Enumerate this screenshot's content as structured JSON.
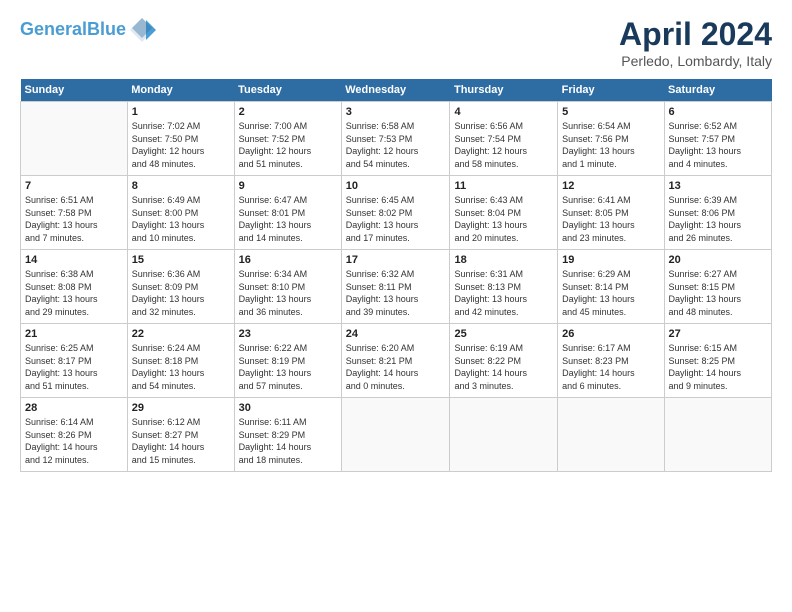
{
  "header": {
    "logo_line1": "General",
    "logo_line2": "Blue",
    "title": "April 2024",
    "subtitle": "Perledo, Lombardy, Italy"
  },
  "days_of_week": [
    "Sunday",
    "Monday",
    "Tuesday",
    "Wednesday",
    "Thursday",
    "Friday",
    "Saturday"
  ],
  "weeks": [
    [
      {
        "day": "",
        "info": ""
      },
      {
        "day": "1",
        "info": "Sunrise: 7:02 AM\nSunset: 7:50 PM\nDaylight: 12 hours\nand 48 minutes."
      },
      {
        "day": "2",
        "info": "Sunrise: 7:00 AM\nSunset: 7:52 PM\nDaylight: 12 hours\nand 51 minutes."
      },
      {
        "day": "3",
        "info": "Sunrise: 6:58 AM\nSunset: 7:53 PM\nDaylight: 12 hours\nand 54 minutes."
      },
      {
        "day": "4",
        "info": "Sunrise: 6:56 AM\nSunset: 7:54 PM\nDaylight: 12 hours\nand 58 minutes."
      },
      {
        "day": "5",
        "info": "Sunrise: 6:54 AM\nSunset: 7:56 PM\nDaylight: 13 hours\nand 1 minute."
      },
      {
        "day": "6",
        "info": "Sunrise: 6:52 AM\nSunset: 7:57 PM\nDaylight: 13 hours\nand 4 minutes."
      }
    ],
    [
      {
        "day": "7",
        "info": "Sunrise: 6:51 AM\nSunset: 7:58 PM\nDaylight: 13 hours\nand 7 minutes."
      },
      {
        "day": "8",
        "info": "Sunrise: 6:49 AM\nSunset: 8:00 PM\nDaylight: 13 hours\nand 10 minutes."
      },
      {
        "day": "9",
        "info": "Sunrise: 6:47 AM\nSunset: 8:01 PM\nDaylight: 13 hours\nand 14 minutes."
      },
      {
        "day": "10",
        "info": "Sunrise: 6:45 AM\nSunset: 8:02 PM\nDaylight: 13 hours\nand 17 minutes."
      },
      {
        "day": "11",
        "info": "Sunrise: 6:43 AM\nSunset: 8:04 PM\nDaylight: 13 hours\nand 20 minutes."
      },
      {
        "day": "12",
        "info": "Sunrise: 6:41 AM\nSunset: 8:05 PM\nDaylight: 13 hours\nand 23 minutes."
      },
      {
        "day": "13",
        "info": "Sunrise: 6:39 AM\nSunset: 8:06 PM\nDaylight: 13 hours\nand 26 minutes."
      }
    ],
    [
      {
        "day": "14",
        "info": "Sunrise: 6:38 AM\nSunset: 8:08 PM\nDaylight: 13 hours\nand 29 minutes."
      },
      {
        "day": "15",
        "info": "Sunrise: 6:36 AM\nSunset: 8:09 PM\nDaylight: 13 hours\nand 32 minutes."
      },
      {
        "day": "16",
        "info": "Sunrise: 6:34 AM\nSunset: 8:10 PM\nDaylight: 13 hours\nand 36 minutes."
      },
      {
        "day": "17",
        "info": "Sunrise: 6:32 AM\nSunset: 8:11 PM\nDaylight: 13 hours\nand 39 minutes."
      },
      {
        "day": "18",
        "info": "Sunrise: 6:31 AM\nSunset: 8:13 PM\nDaylight: 13 hours\nand 42 minutes."
      },
      {
        "day": "19",
        "info": "Sunrise: 6:29 AM\nSunset: 8:14 PM\nDaylight: 13 hours\nand 45 minutes."
      },
      {
        "day": "20",
        "info": "Sunrise: 6:27 AM\nSunset: 8:15 PM\nDaylight: 13 hours\nand 48 minutes."
      }
    ],
    [
      {
        "day": "21",
        "info": "Sunrise: 6:25 AM\nSunset: 8:17 PM\nDaylight: 13 hours\nand 51 minutes."
      },
      {
        "day": "22",
        "info": "Sunrise: 6:24 AM\nSunset: 8:18 PM\nDaylight: 13 hours\nand 54 minutes."
      },
      {
        "day": "23",
        "info": "Sunrise: 6:22 AM\nSunset: 8:19 PM\nDaylight: 13 hours\nand 57 minutes."
      },
      {
        "day": "24",
        "info": "Sunrise: 6:20 AM\nSunset: 8:21 PM\nDaylight: 14 hours\nand 0 minutes."
      },
      {
        "day": "25",
        "info": "Sunrise: 6:19 AM\nSunset: 8:22 PM\nDaylight: 14 hours\nand 3 minutes."
      },
      {
        "day": "26",
        "info": "Sunrise: 6:17 AM\nSunset: 8:23 PM\nDaylight: 14 hours\nand 6 minutes."
      },
      {
        "day": "27",
        "info": "Sunrise: 6:15 AM\nSunset: 8:25 PM\nDaylight: 14 hours\nand 9 minutes."
      }
    ],
    [
      {
        "day": "28",
        "info": "Sunrise: 6:14 AM\nSunset: 8:26 PM\nDaylight: 14 hours\nand 12 minutes."
      },
      {
        "day": "29",
        "info": "Sunrise: 6:12 AM\nSunset: 8:27 PM\nDaylight: 14 hours\nand 15 minutes."
      },
      {
        "day": "30",
        "info": "Sunrise: 6:11 AM\nSunset: 8:29 PM\nDaylight: 14 hours\nand 18 minutes."
      },
      {
        "day": "",
        "info": ""
      },
      {
        "day": "",
        "info": ""
      },
      {
        "day": "",
        "info": ""
      },
      {
        "day": "",
        "info": ""
      }
    ]
  ]
}
